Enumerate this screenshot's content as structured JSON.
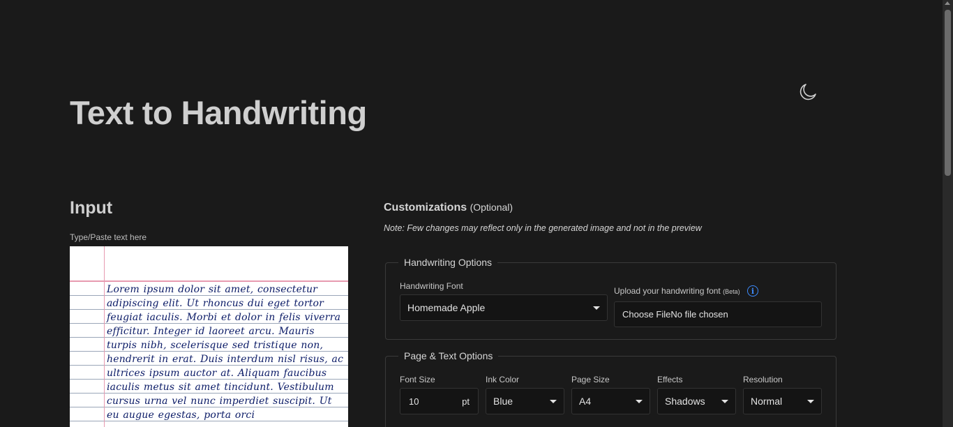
{
  "header": {
    "title": "Text to Handwriting",
    "theme_icon": "moon-icon"
  },
  "input": {
    "title": "Input",
    "label": "Type/Paste text here",
    "text": "Lorem ipsum dolor sit amet, consectetur adipiscing elit. Ut rhoncus dui eget tortor feugiat iaculis. Morbi et dolor in felis viverra efficitur. Integer id laoreet arcu. Mauris turpis nibh, scelerisque sed tristique non, hendrerit in erat. Duis interdum nisl risus, ac ultrices ipsum auctor at. Aliquam faucibus iaculis metus sit amet tincidunt. Vestibulum cursus urna vel nunc imperdiet suscipit. Ut eu augue egestas, porta orci"
  },
  "customizations": {
    "title": "Customizations",
    "optional": "(Optional)",
    "note": "Note: Few changes may reflect only in the generated image and not in the preview"
  },
  "handwriting_options": {
    "legend": "Handwriting Options",
    "font_label": "Handwriting Font",
    "font_value": "Homemade Apple",
    "upload_label": "Upload your handwriting font",
    "upload_beta": "(Beta)",
    "info_icon": "info-icon",
    "file_button": "Choose File",
    "file_status": "No file chosen"
  },
  "page_text_options": {
    "legend": "Page & Text Options",
    "font_size_label": "Font Size",
    "font_size_value": "10",
    "font_size_unit": "pt",
    "ink_color_label": "Ink Color",
    "ink_color_value": "Blue",
    "page_size_label": "Page Size",
    "page_size_value": "A4",
    "effects_label": "Effects",
    "effects_value": "Shadows",
    "resolution_label": "Resolution",
    "resolution_value": "Normal"
  },
  "colors": {
    "background": "#1a1a1a",
    "ink": "#0a1a66",
    "margin_line": "#e79ab0",
    "accent": "#3d8bfd"
  }
}
